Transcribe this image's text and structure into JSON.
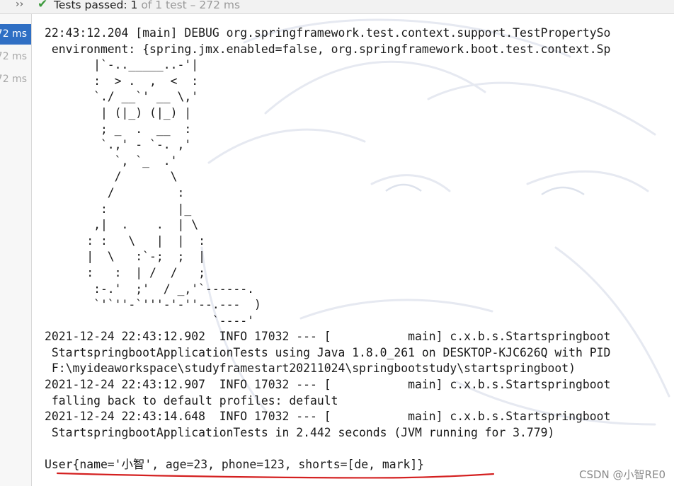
{
  "header": {
    "expand_glyph": "››",
    "status_icon": "check-icon",
    "status_strong": "Tests passed: 1",
    "status_muted": " of 1 test – 272 ms"
  },
  "sidebar": {
    "rows": [
      {
        "label": "72 ms",
        "selected": true
      },
      {
        "label": "72 ms",
        "selected": false
      },
      {
        "label": "72 ms",
        "selected": false
      }
    ]
  },
  "console": {
    "lines": [
      "22:43:12.204 [main] DEBUG org.springframework.test.context.support.TestPropertySo",
      " environment: {spring.jmx.enabled=false, org.springframework.boot.test.context.Sp",
      "       |`-.._____..-'|",
      "       :  > .  ,  <  :",
      "       `./ __`' __ \\,'",
      "        | (|_) (|_) |",
      "        ; _  .  __  :",
      "        `.,' - `-. ,'",
      "          `, `_  .'",
      "          /       \\",
      "         /         :",
      "        :          |_",
      "       ,|  .    .  | \\",
      "      : :   \\   |  |  :",
      "      |  \\   :`-;  ;  |",
      "      :   :  | /  /   ;",
      "       :-.'  ;'  / _,'`------.",
      "       `'`''-`'''-'-''--.---  )",
      "                        `----'",
      "2021-12-24 22:43:12.902  INFO 17032 --- [           main] c.x.b.s.Startspringboot",
      " StartspringbootApplicationTests using Java 1.8.0_261 on DESKTOP-KJC626Q with PID",
      " F:\\myideaworkspace\\studyframestart20211024\\springbootstudy\\startspringboot)",
      "2021-12-24 22:43:12.907  INFO 17032 --- [           main] c.x.b.s.Startspringboot",
      " falling back to default profiles: default",
      "2021-12-24 22:43:14.648  INFO 17032 --- [           main] c.x.b.s.Startspringboot",
      " StartspringbootApplicationTests in 2.442 seconds (JVM running for 3.779)",
      "",
      "User{name='小智', age=23, phone=123, shorts=[de, mark]}"
    ]
  },
  "watermark": {
    "text": "CSDN @小智RE0"
  },
  "colors": {
    "selection": "#2f6fc4",
    "pass_green": "#3c9a3c",
    "annotation_red": "#d42020"
  }
}
